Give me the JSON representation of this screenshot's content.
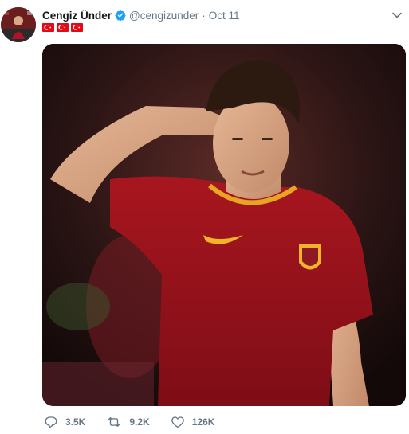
{
  "tweet": {
    "display_name": "Cengiz Ünder",
    "handle": "@cengizunder",
    "separator": "·",
    "timestamp": "Oct 11",
    "verified": true,
    "bio_flags": [
      "turkey-flag",
      "turkey-flag",
      "turkey-flag"
    ]
  },
  "actions": {
    "reply_count": "3.5K",
    "retweet_count": "9.2K",
    "like_count": "126K"
  },
  "colors": {
    "verified_blue": "#1da1f2",
    "muted_text": "#657786",
    "flag_red": "#e30a17"
  }
}
